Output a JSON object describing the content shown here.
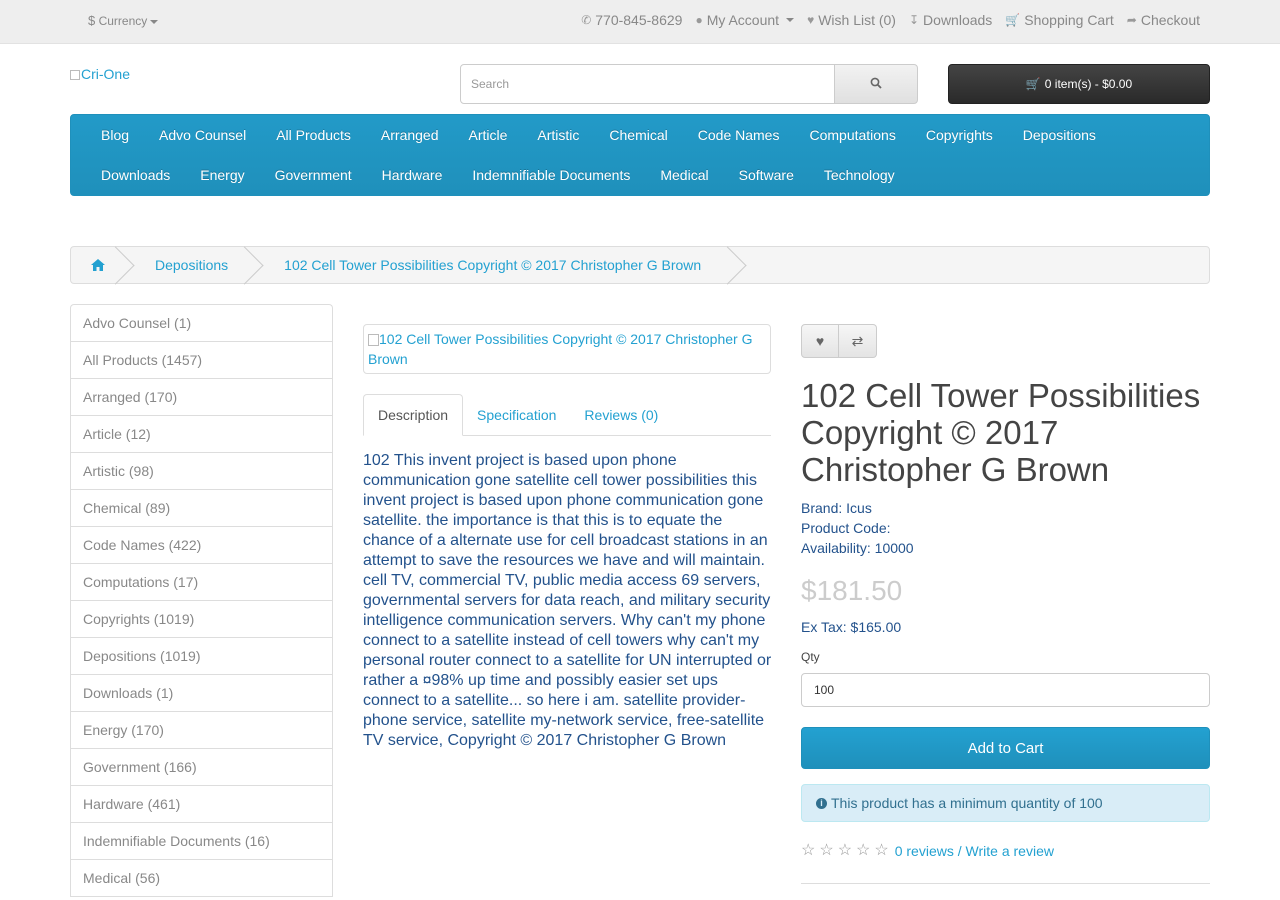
{
  "topbar": {
    "currency_symbol": "$",
    "currency_label": "Currency",
    "phone": "770-845-8629",
    "my_account": "My Account",
    "wish_list": "Wish List (0)",
    "downloads": "Downloads",
    "shopping_cart": "Shopping Cart",
    "checkout": "Checkout"
  },
  "header": {
    "logo_alt": "Cri-One",
    "search_placeholder": "Search",
    "cart_summary": "0 item(s) - $0.00"
  },
  "menu": {
    "row1": [
      "Blog",
      "Advo Counsel",
      "All Products",
      "Arranged",
      "Article",
      "Artistic",
      "Chemical",
      "Code Names",
      "Computations",
      "Copyrights",
      "Depositions"
    ],
    "row2": [
      "Downloads",
      "Energy",
      "Government",
      "Hardware",
      "Indemnifiable Documents",
      "Medical",
      "Software",
      "Technology"
    ]
  },
  "breadcrumb": {
    "category": "Depositions",
    "product": "102 Cell Tower Possibilities Copyright © 2017 Christopher G Brown"
  },
  "categories": [
    "Advo Counsel (1)",
    "All Products (1457)",
    "Arranged (170)",
    "Article (12)",
    "Artistic (98)",
    "Chemical (89)",
    "Code Names (422)",
    "Computations (17)",
    "Copyrights (1019)",
    "Depositions (1019)",
    "Downloads (1)",
    "Energy (170)",
    "Government (166)",
    "Hardware (461)",
    "Indemnifiable Documents (16)",
    "Medical (56)"
  ],
  "product": {
    "image_alt": "102 Cell Tower Possibilities Copyright © 2017 Christopher G Brown",
    "tabs": [
      "Description",
      "Specification",
      "Reviews (0)"
    ],
    "description": "102 This invent project is based upon phone communication gone satellite cell tower possibilities this invent project is based upon phone communication gone satellite. the importance is that this is to equate the chance of a alternate use for cell broadcast stations in an attempt to save the resources we have and will maintain. cell TV, commercial TV, public media access 69 servers, governmental servers for data reach, and military security intelligence communication servers. Why can't my phone connect to a satellite instead of cell towers why can't my personal router connect to a satellite for UN interrupted or rather a ¤98% up time and possibly easier set ups connect to a satellite... so here i am. satellite provider- phone service, satellite my-network service, free-satellite TV service, Copyright © 2017 Christopher G Brown",
    "title": "102 Cell Tower Possibilities Copyright © 2017 Christopher G Brown",
    "brand": "Brand: Icus",
    "product_code": "Product Code:",
    "availability": "Availability: 10000",
    "price": "$181.50",
    "ex_tax": "Ex Tax: $165.00",
    "qty_label": "Qty",
    "qty_value": "100",
    "add_to_cart": "Add to Cart",
    "min_qty_notice": "This product has a minimum quantity of 100",
    "rating_stars": 0,
    "reviews_link": "0 reviews",
    "write_review_link": "Write a review",
    "separator": "/"
  },
  "icons": {
    "currency": "dollar-icon",
    "phone": "phone-icon",
    "account": "user-icon",
    "wishlist": "heart-icon",
    "downloads": "download-icon",
    "cart": "shopping-cart-icon",
    "checkout": "share-icon",
    "search": "search-icon",
    "home": "home-icon",
    "compare": "exchange-icon",
    "info": "info-circle-icon",
    "star": "star-outline-icon"
  },
  "colors": {
    "accent": "#229ac8",
    "link": "#23a1d1",
    "text_dark": "#444444",
    "cart_button": "#363636",
    "alert_bg": "#d9edf7"
  }
}
